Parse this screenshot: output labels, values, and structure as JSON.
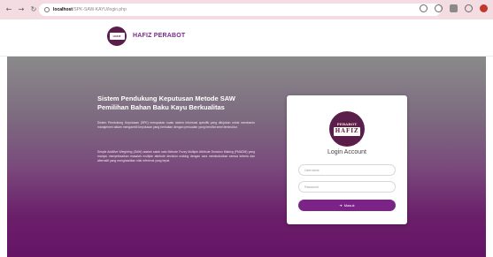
{
  "browser": {
    "back_icon": "←",
    "forward_icon": "→",
    "reload_icon": "↻",
    "url_host": "localhost",
    "url_path": "/SPK-SAW-KAYU/login.php"
  },
  "header": {
    "logo_plate_text": "HAFIZ",
    "brand_name": "HAFIZ PERABOT"
  },
  "hero": {
    "title": "Sistem Pendukung Keputusan Metode SAW Pemilihan Bahan Baku Kayu Berkualitas",
    "paragraph1": "Sistem Pendukung Keputusan (SPK) merupakan suatu sistem informasi spesifik yang ditujukan untuk membantu manajemen dalam mengambil keputusan yang berkaitan dengan persoalan yang bersifat semi terstruktur.",
    "paragraph2": "Simple Additive Weighting (SAW) adalah salah satu Metode Fuzzy Multiple Attribute Decision Making (FMADM) yang mampu menyelesaikan masalah multiple attribute decision making dengan cara membobotkan semua kriteria dan alternatif yang menghasilkan nilai referensi yang tepat."
  },
  "login": {
    "logo_top": "PERABOT",
    "logo_plate": "HAFIZ",
    "title": "Login Account",
    "username_placeholder": "Username",
    "password_placeholder": "Password",
    "button_icon": "➜",
    "button_label": "Masuk"
  }
}
